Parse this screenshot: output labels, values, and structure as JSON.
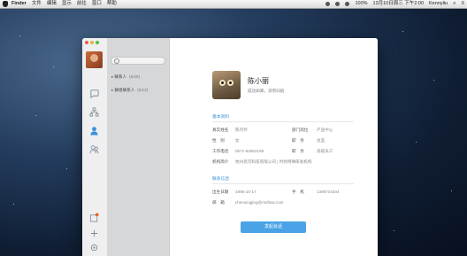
{
  "menubar": {
    "app": "Finder",
    "items": [
      "文件",
      "编辑",
      "显示",
      "前往",
      "窗口",
      "帮助"
    ],
    "battery": "100%",
    "datetime": "12月10日周三 下午2:00",
    "user": "Kennyliu"
  },
  "sidebar": {
    "search_placeholder": "",
    "groups": [
      {
        "label": "联系人",
        "count": "(6/46)"
      },
      {
        "label": "群组联系人",
        "count": "(5/12)"
      }
    ]
  },
  "profile": {
    "name": "陈小丽",
    "signature": "成功如来，没有归宿",
    "basic_title": "基本资料",
    "fields": [
      {
        "label": "真实姓名",
        "value": "陈丹玲"
      },
      {
        "label": "部门岗位",
        "value": "产品中心"
      },
      {
        "label": "性　别",
        "value": "女"
      },
      {
        "label": "职　务",
        "value": "总监"
      },
      {
        "label": "工作电话",
        "value": "0571-83062188"
      },
      {
        "label": "职　务",
        "value": "高级员工"
      },
      {
        "label": "机构简介",
        "value": "杭州思可科技有限公司 | 时尚特殊研发机构"
      }
    ],
    "contact_title": "联系信息",
    "contact": [
      {
        "label": "出生日期",
        "value": "1986-10-17"
      },
      {
        "label": "手　机",
        "value": "1389734404"
      },
      {
        "label": "邮　箱",
        "value": "chenxingjing@msftow.com"
      }
    ],
    "action": "发起会话"
  }
}
